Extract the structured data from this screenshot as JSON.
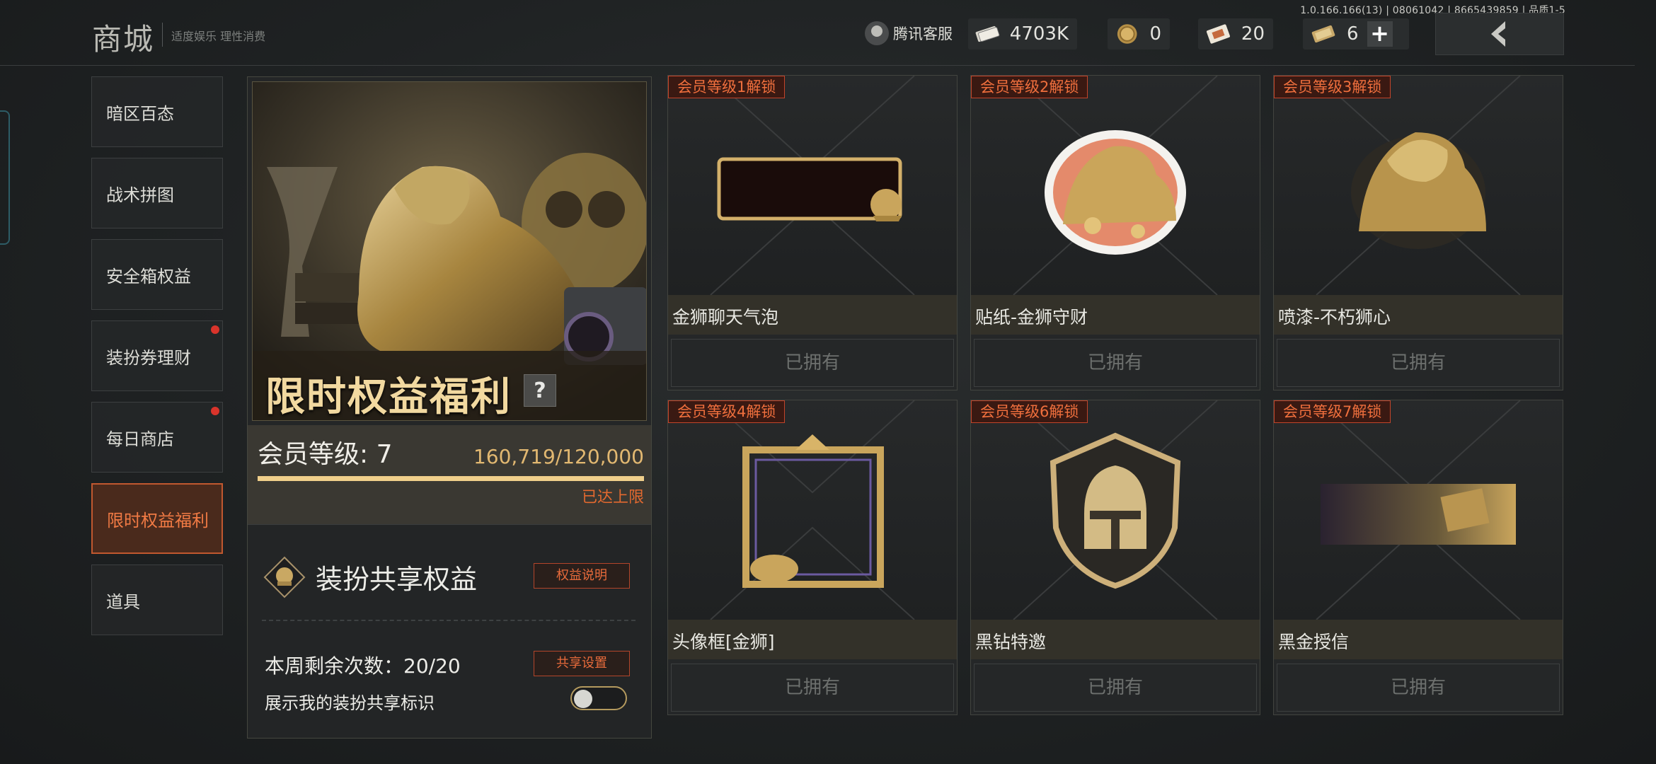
{
  "version": "1.0.166.166(13) | 08061042 | 8665439859 | 品质1-5",
  "header": {
    "title": "商城",
    "tagline": "适度娱乐 理性消费",
    "service_label": "腾讯客服",
    "currencies": [
      {
        "icon": "cash-icon",
        "value": "4703K"
      },
      {
        "icon": "coin-icon",
        "value": "0"
      },
      {
        "icon": "ticket-icon",
        "value": "20"
      },
      {
        "icon": "voucher-icon",
        "value": "6"
      }
    ]
  },
  "sidebar": {
    "items": [
      {
        "label": "暗区百态",
        "active": false,
        "dot": false
      },
      {
        "label": "战术拼图",
        "active": false,
        "dot": false
      },
      {
        "label": "安全箱权益",
        "active": false,
        "dot": false
      },
      {
        "label": "装扮券理财",
        "active": false,
        "dot": true
      },
      {
        "label": "每日商店",
        "active": false,
        "dot": true
      },
      {
        "label": "限时权益福利",
        "active": true,
        "dot": false
      },
      {
        "label": "道具",
        "active": false,
        "dot": false
      }
    ]
  },
  "promo": {
    "title": "限时权益福利",
    "help": "?",
    "level_label": "会员等级: 7",
    "points": "160,719/120,000",
    "progress": 1.0,
    "max_label": "已达上限",
    "share_title": "装扮共享权益",
    "rules_button": "权益说明",
    "weekly_label": "本周剩余次数：20/20",
    "share_settings_button": "共享设置",
    "show_mark_label": "展示我的装扮共享标识",
    "show_mark_enabled": false
  },
  "rewards": [
    {
      "tag": "会员等级1解锁",
      "name": "金狮聊天气泡",
      "status": "已拥有",
      "art": "chat-bubble"
    },
    {
      "tag": "会员等级2解锁",
      "name": "贴纸-金狮守财",
      "status": "已拥有",
      "art": "sticker"
    },
    {
      "tag": "会员等级3解锁",
      "name": "喷漆-不朽狮心",
      "status": "已拥有",
      "art": "spray"
    },
    {
      "tag": "会员等级4解锁",
      "name": "头像框[金狮]",
      "status": "已拥有",
      "art": "frame"
    },
    {
      "tag": "会员等级6解锁",
      "name": "黑钻特邀",
      "status": "已拥有",
      "art": "emblem"
    },
    {
      "tag": "会员等级7解锁",
      "name": "黑金授信",
      "status": "已拥有",
      "art": "card"
    }
  ],
  "colors": {
    "accent_orange": "#e86b3b",
    "gold": "#f0cf8b",
    "dot_red": "#d9342b"
  }
}
